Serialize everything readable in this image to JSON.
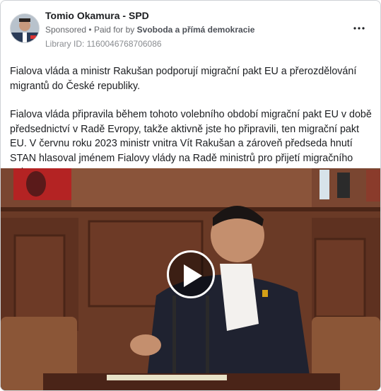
{
  "ad": {
    "page_name": "Tomio Okamura - SPD",
    "sponsored_label": "Sponsored",
    "separator": "•",
    "paid_for_by_prefix": "Paid for by",
    "paid_for_by_name": "Svoboda a přímá demokracie",
    "library_id": "Library ID: 1160046768706086",
    "more_options_icon": "more-horizontal-icon"
  },
  "body": {
    "paragraph1": "Fialova vláda a ministr Rakušan podporují migrační pakt EU a přerozdělování migrantů do České republiky.",
    "paragraph2": "Fialova vláda připravila během tohoto volebního období migrační pakt EU v době předsednictví v Radě Evropy, takže aktivně jste ho připravili, ten migrační pakt EU. V červnu roku 2023 ministr vnitra Vít Rakušan a zároveň předseda hnutí STAN hlasoval jménem Fialovy vlády na Radě ministrů pro přijetí migračního paktu EU. ..."
  },
  "media": {
    "type": "video",
    "play_icon": "play-icon"
  }
}
